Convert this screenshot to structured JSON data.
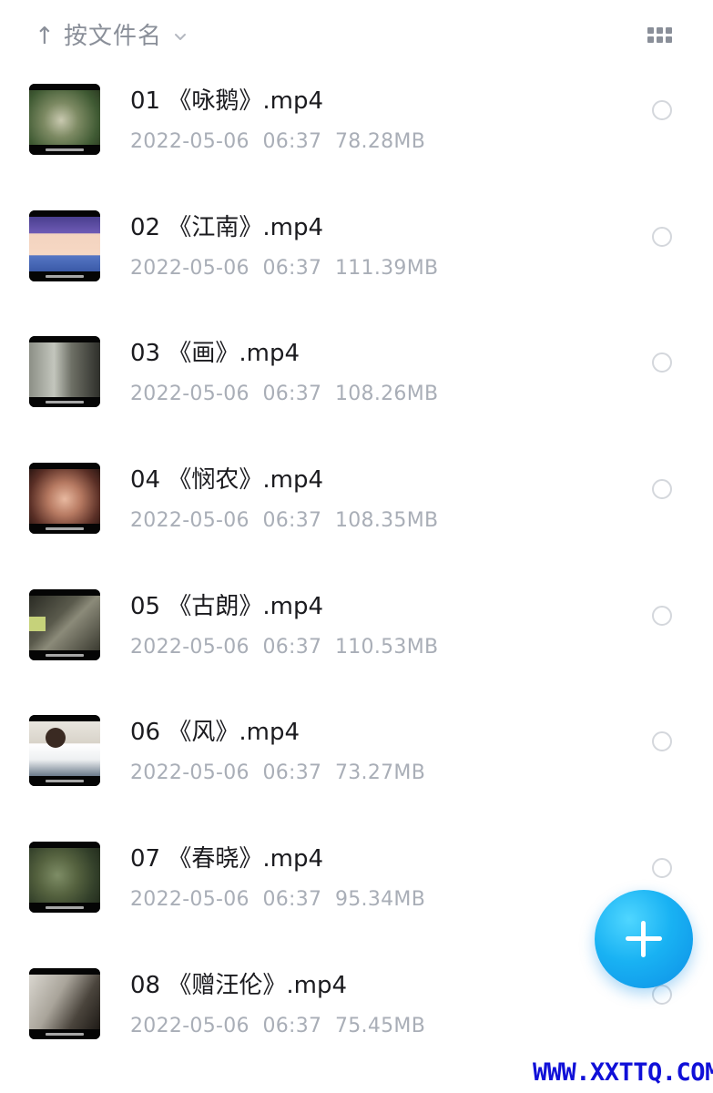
{
  "sort": {
    "arrow": "↑",
    "label": "按文件名"
  },
  "files": [
    {
      "name": "01 《咏鹅》.mp4",
      "date": "2022-05-06",
      "time": "06:37",
      "size": "78.28MB"
    },
    {
      "name": "02 《江南》.mp4",
      "date": "2022-05-06",
      "time": "06:37",
      "size": "111.39MB"
    },
    {
      "name": "03 《画》.mp4",
      "date": "2022-05-06",
      "time": "06:37",
      "size": "108.26MB"
    },
    {
      "name": "04 《悯农》.mp4",
      "date": "2022-05-06",
      "time": "06:37",
      "size": "108.35MB"
    },
    {
      "name": "05 《古朗》.mp4",
      "date": "2022-05-06",
      "time": "06:37",
      "size": "110.53MB"
    },
    {
      "name": "06 《风》.mp4",
      "date": "2022-05-06",
      "time": "06:37",
      "size": "73.27MB"
    },
    {
      "name": "07 《春晓》.mp4",
      "date": "2022-05-06",
      "time": "06:37",
      "size": "95.34MB"
    },
    {
      "name": "08 《赠汪伦》.mp4",
      "date": "2022-05-06",
      "time": "06:37",
      "size": "75.45MB"
    }
  ],
  "watermark": "WWW.XXTTQ.COM",
  "colors": {
    "accent": "#19b2f3",
    "watermark": "#1010d8",
    "meta_text": "#a9aeb7"
  },
  "icons": {
    "sort": "arrow-up-icon",
    "dropdown": "chevron-down-icon",
    "view": "grid-view-icon",
    "fab": "plus-icon"
  }
}
